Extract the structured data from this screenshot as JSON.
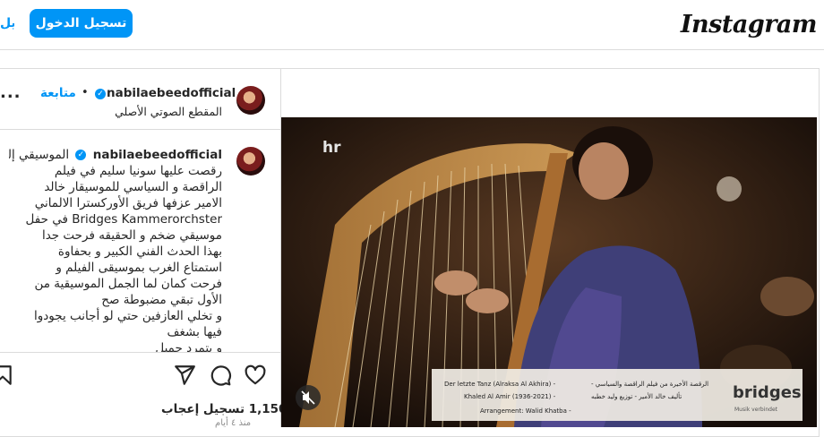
{
  "header": {
    "logo": "Instagram",
    "login_label": "تسجيل الدخول",
    "signup_label": "تسجيل"
  },
  "post": {
    "username": "nabilaebeedofficial",
    "follow_label": "متابعة",
    "dot": "•",
    "audio_label": "المقطع الصوتي الأصلي",
    "more_label": "..."
  },
  "caption": {
    "username": "nabilaebeedofficial",
    "first_line": "الموسيقي إللي",
    "body": "رقصت عليها سونيا سليم في فيلم\nالراقصة و السياسي للموسيقار خالد\nالامير عزفها فريق الأوركسترا الالماني\nBridges Kammerorchster في حفل\nموسيقي ضخم و الحقيقه فرحت جدا\nبهذا الحدث الفني الكبير و بحفاوة\nاستمتاع الغرب بموسيقى الفيلم و\nفرحت كمان لما الجمل الموسيقية من\nالأول تبقي مضبوطة صح\nو تخلي العازفين حتي لو أجانب يجودوا\nفيها بشغف\nو بتمرد جميل"
  },
  "engagement": {
    "likes_text": "1,150 تسجيل إعجاب",
    "time_text": "منذ ٤ أيام"
  },
  "video": {
    "channel_logo": "hr",
    "banner_title": "Der letzte Tanz (Alraksa Al Akhira) -",
    "banner_title_ar": "الرقصة الأخيرة من فيلم الراقصة والسياسي -",
    "banner_composer": "Khaled Al Amir (1936-2021) -",
    "banner_composer_ar": "تأليف خالد الأمير - توزيع وليد خطبه",
    "banner_arranger": "Arrangement: Walid Khatba -",
    "brand": "bridges",
    "brand_sub": "Musik verbindet"
  },
  "colors": {
    "accent": "#0095f6",
    "border": "#dbdbdb",
    "text": "#262626"
  }
}
